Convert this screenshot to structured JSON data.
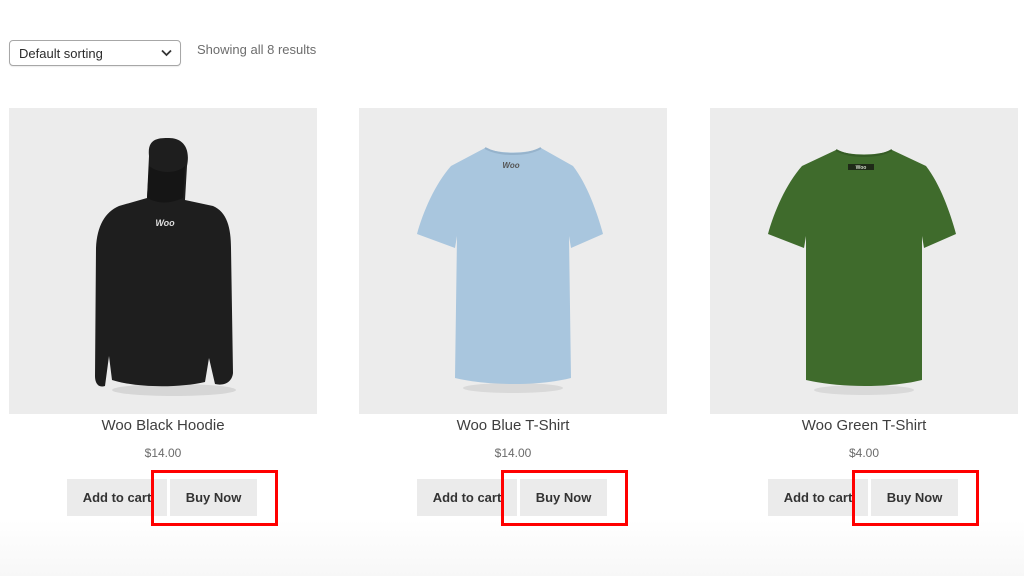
{
  "toolbar": {
    "sort_selected": "Default sorting",
    "result_count": "Showing all 8 results"
  },
  "products": [
    {
      "name": "Woo Black Hoodie",
      "price": "$14.00",
      "add_to_cart": "Add to cart",
      "buy_now": "Buy Now",
      "image_logo": "Woo",
      "garment_color": "#1e1e1e"
    },
    {
      "name": "Woo Blue T-Shirt",
      "price": "$14.00",
      "add_to_cart": "Add to cart",
      "buy_now": "Buy Now",
      "image_logo": "Woo",
      "garment_color": "#a9c6de"
    },
    {
      "name": "Woo Green T-Shirt",
      "price": "$4.00",
      "add_to_cart": "Add to cart",
      "buy_now": "Buy Now",
      "image_logo": "Woo",
      "garment_color": "#3f6b2c"
    }
  ],
  "highlight_color": "#ff0000",
  "icons": {
    "sort_chevron": "chevron-down-icon"
  }
}
